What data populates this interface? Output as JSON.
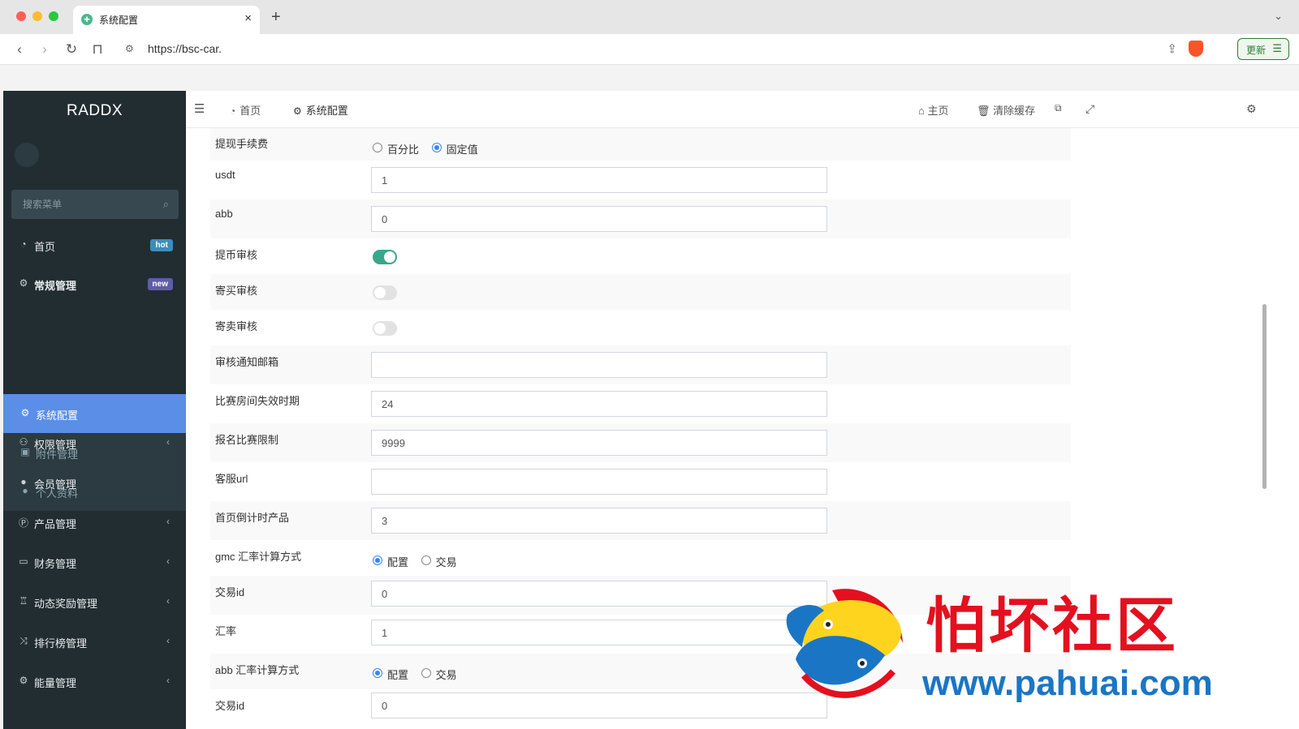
{
  "browser": {
    "tab_title": "系统配置",
    "url": "https://bsc-car.",
    "update_label": "更新"
  },
  "sidebar": {
    "logo": "RADDX",
    "search_placeholder": "搜索菜单",
    "items": [
      {
        "label": "首页",
        "icon": "dashboard-icon",
        "badge": "hot"
      },
      {
        "label": "常规管理",
        "icon": "cogs-icon",
        "badge": "new"
      },
      {
        "label": "权限管理",
        "icon": "group-icon"
      },
      {
        "label": "会员管理",
        "icon": "user-icon"
      },
      {
        "label": "产品管理",
        "icon": "product-icon"
      },
      {
        "label": "财务管理",
        "icon": "credit-card-icon"
      },
      {
        "label": "动态奖励管理",
        "icon": "trophy-icon"
      },
      {
        "label": "排行榜管理",
        "icon": "random-icon"
      },
      {
        "label": "能量管理",
        "icon": "gear-icon"
      }
    ],
    "submenu": [
      {
        "label": "系统配置",
        "icon": "gear-icon",
        "active": true
      },
      {
        "label": "附件管理",
        "icon": "file-image-icon"
      },
      {
        "label": "个人资料",
        "icon": "user-icon"
      }
    ]
  },
  "header": {
    "tabs": [
      {
        "label": "首页",
        "icon": "dashboard-icon"
      },
      {
        "label": "系统配置",
        "icon": "gear-icon"
      }
    ],
    "home_label": "主页",
    "clear_cache_label": "清除缓存"
  },
  "form": {
    "withdraw_fee": {
      "label": "提现手续费",
      "options": [
        "百分比",
        "固定值"
      ],
      "selected": "固定值"
    },
    "usdt": {
      "label": "usdt",
      "value": "1"
    },
    "abb": {
      "label": "abb",
      "value": "0"
    },
    "withdraw_review": {
      "label": "提币审核",
      "on": true
    },
    "consign_buy_review": {
      "label": "寄买审核",
      "on": false
    },
    "consign_sell_review": {
      "label": "寄卖审核",
      "on": false
    },
    "review_email": {
      "label": "审核通知邮箱",
      "value": ""
    },
    "room_expiry": {
      "label": "比赛房间失效时期",
      "value": "24"
    },
    "signup_limit": {
      "label": "报名比赛限制",
      "value": "9999"
    },
    "service_url": {
      "label": "客服url",
      "value": ""
    },
    "countdown_product": {
      "label": "首页倒计时产品",
      "value": "3"
    },
    "gmc_rate_method": {
      "label": "gmc 汇率计算方式",
      "options": [
        "配置",
        "交易"
      ],
      "selected": "配置"
    },
    "trade_id_1": {
      "label": "交易id",
      "value": "0"
    },
    "rate": {
      "label": "汇率",
      "value": "1"
    },
    "abb_rate_method": {
      "label": "abb 汇率计算方式",
      "options": [
        "配置",
        "交易"
      ],
      "selected": "配置"
    },
    "trade_id_2": {
      "label": "交易id",
      "value": "0"
    }
  },
  "watermark": {
    "title": "怕坏社区",
    "url": "www.pahuai.com"
  },
  "colors": {
    "sidebar_bg": "#222d32",
    "active_item": "#5b8ee6",
    "switch_on": "#3aa68a",
    "badge_hot": "#3c8dbc",
    "badge_new": "#605ca8"
  }
}
